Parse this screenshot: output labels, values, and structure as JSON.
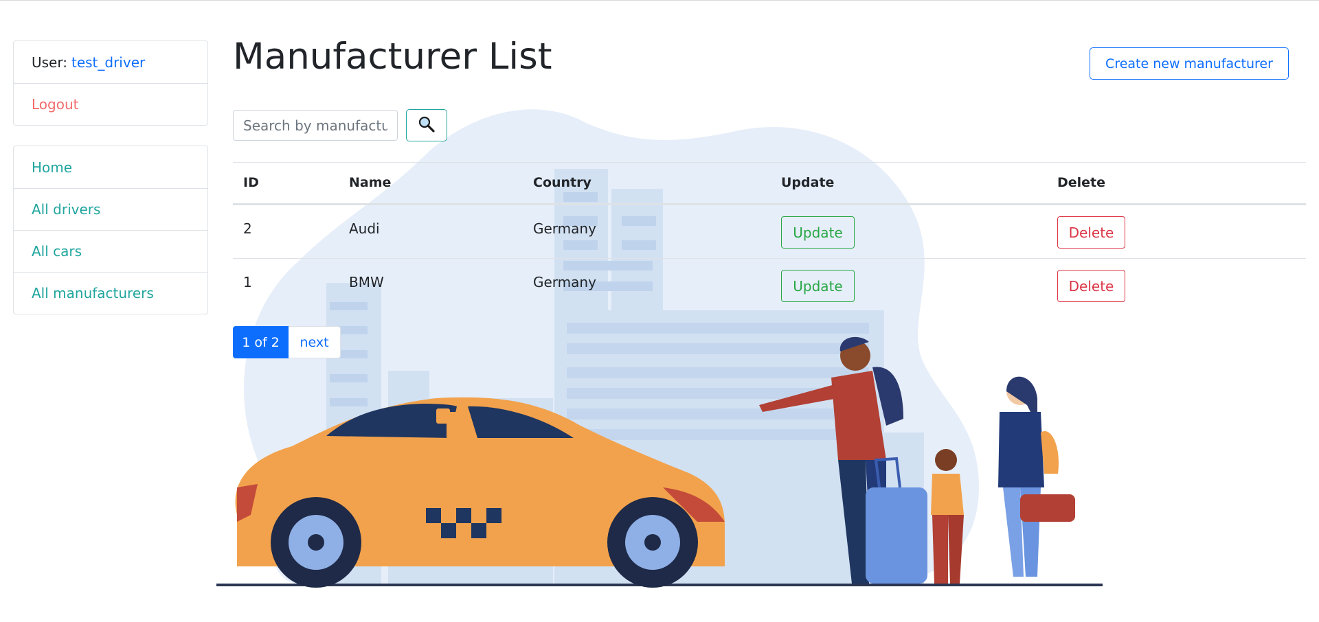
{
  "sidebar": {
    "user_label": "User:",
    "username": "test_driver",
    "logout": "Logout",
    "nav": [
      "Home",
      "All drivers",
      "All cars",
      "All manufacturers"
    ]
  },
  "page": {
    "title": "Manufacturer List",
    "create_button": "Create new manufacturer"
  },
  "search": {
    "placeholder": "Search by manufacturer",
    "button_icon": "search-icon"
  },
  "table": {
    "headers": [
      "ID",
      "Name",
      "Country",
      "Update",
      "Delete"
    ],
    "rows": [
      {
        "id": "2",
        "name": "Audi",
        "country": "Germany",
        "update": "Update",
        "delete": "Delete"
      },
      {
        "id": "1",
        "name": "BMW",
        "country": "Germany",
        "update": "Update",
        "delete": "Delete"
      }
    ]
  },
  "pagination": {
    "current": "1 of 2",
    "next": "next"
  },
  "colors": {
    "primary": "#0d6efd",
    "teal": "#20a59e",
    "success": "#28a745",
    "danger": "#dc3545",
    "logout": "#f26b6b"
  }
}
